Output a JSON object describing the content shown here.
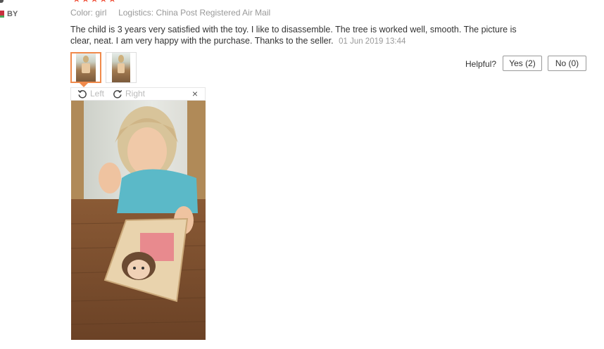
{
  "rating": {
    "stars": "★★★★★"
  },
  "buyer": {
    "country": "BY"
  },
  "properties": {
    "color_label": "Color:",
    "color_value": "girl",
    "logistics_label": "Logistics:",
    "logistics_value": "China Post Registered Air Mail"
  },
  "review": {
    "text": "The child is 3 years very satisfied with the toy. I like to disassemble. The tree is worked well, smooth. The picture is clear, neat. I am very happy with the purchase. Thanks to the seller.",
    "date": "01 Jun 2019 13:44"
  },
  "helpful": {
    "label": "Helpful?",
    "yes_label": "Yes (2)",
    "no_label": "No (0)"
  },
  "viewer": {
    "rotate_left_label": "Left",
    "rotate_right_label": "Right",
    "close_label": "×"
  },
  "colors": {
    "star": "#f0533c",
    "thumb_active_border": "#f08a4b",
    "muted_text": "#999999"
  }
}
